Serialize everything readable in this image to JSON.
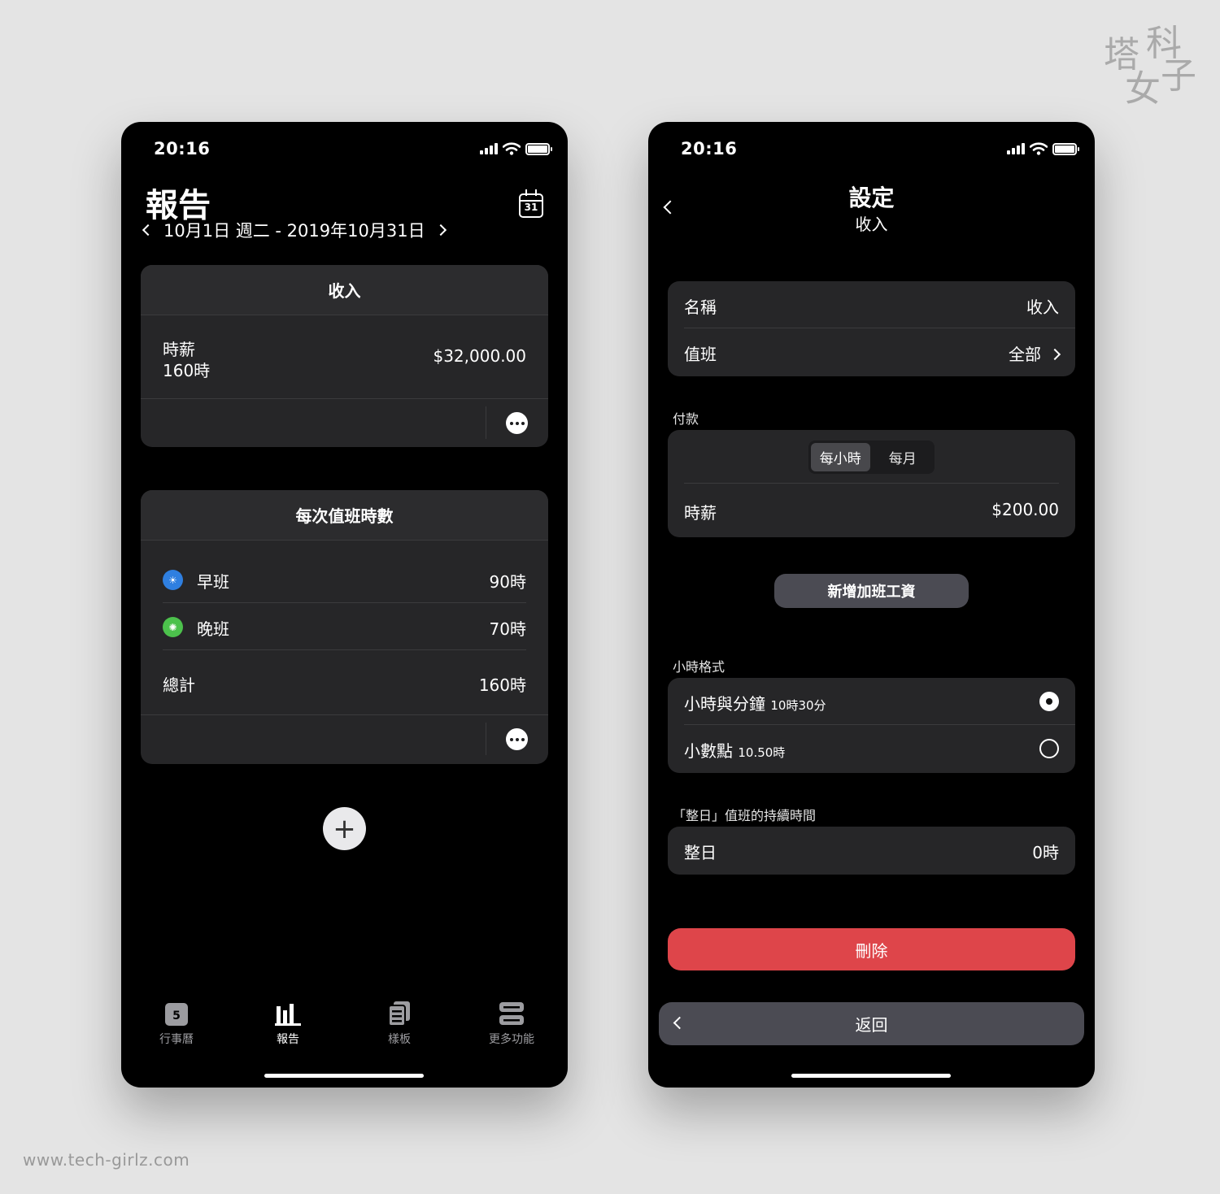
{
  "watermark": {
    "chars": [
      "塔",
      "科",
      "女",
      "子"
    ],
    "site": "www.tech-girlz.com"
  },
  "status": {
    "time": "20:16"
  },
  "report": {
    "title": "報告",
    "date_range": "10月1日 週二 - 2019年10月31日",
    "calendar_day": "31",
    "income_card": {
      "header": "收入",
      "label": "時薪",
      "hours": "160時",
      "amount": "$32,000.00"
    },
    "shift_card": {
      "header": "每次值班時數",
      "rows": [
        {
          "name": "早班",
          "value": "90時",
          "color": "#2f7fe0",
          "icon": "sunrise-icon"
        },
        {
          "name": "晚班",
          "value": "70時",
          "color": "#4cc14c",
          "icon": "sun-icon"
        }
      ],
      "total_label": "總計",
      "total_value": "160時"
    },
    "add_label": "+",
    "tabs": [
      {
        "label": "行事曆",
        "icon": "calendar-icon",
        "badge": "5"
      },
      {
        "label": "報告",
        "icon": "bar-chart-icon",
        "active": true
      },
      {
        "label": "樣板",
        "icon": "templates-icon"
      },
      {
        "label": "更多功能",
        "icon": "more-features-icon"
      }
    ]
  },
  "settings": {
    "title": "設定",
    "subtitle": "收入",
    "name_label": "名稱",
    "name_value": "收入",
    "shift_label": "值班",
    "shift_value": "全部",
    "payment_section": "付款",
    "segments": [
      "每小時",
      "每月"
    ],
    "selected_segment": "每小時",
    "rate_label": "時薪",
    "rate_value": "$200.00",
    "add_overtime": "新增加班工資",
    "hour_format_section": "小時格式",
    "format_options": [
      {
        "label": "小時與分鐘",
        "example": "10時30分",
        "selected": true
      },
      {
        "label": "小數點",
        "example": "10.50時",
        "selected": false
      }
    ],
    "fullday_section": "「整日」值班的持續時間",
    "fullday_label": "整日",
    "fullday_value": "0時",
    "delete_label": "刪除",
    "back_label": "返回"
  }
}
